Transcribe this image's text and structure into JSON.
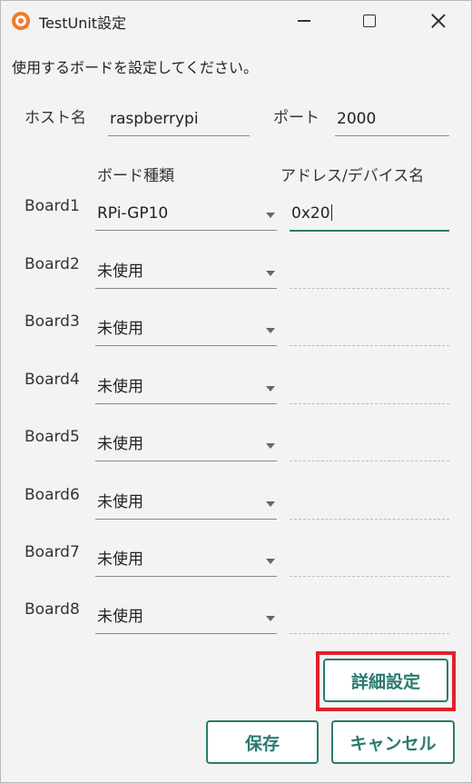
{
  "window": {
    "title": "TestUnit設定"
  },
  "instruction": "使用するボードを設定してください。",
  "host": {
    "label": "ホスト名",
    "value": "raspberrypi"
  },
  "port": {
    "label": "ポート",
    "value": "2000"
  },
  "columns": {
    "board_type": "ボード種類",
    "address": "アドレス/デバイス名"
  },
  "boards": [
    {
      "label": "Board1",
      "type": "RPi-GP10",
      "address": "0x20"
    },
    {
      "label": "Board2",
      "type": "未使用",
      "address": ""
    },
    {
      "label": "Board3",
      "type": "未使用",
      "address": ""
    },
    {
      "label": "Board4",
      "type": "未使用",
      "address": ""
    },
    {
      "label": "Board5",
      "type": "未使用",
      "address": ""
    },
    {
      "label": "Board6",
      "type": "未使用",
      "address": ""
    },
    {
      "label": "Board7",
      "type": "未使用",
      "address": ""
    },
    {
      "label": "Board8",
      "type": "未使用",
      "address": ""
    }
  ],
  "buttons": {
    "advanced": "詳細設定",
    "save": "保存",
    "cancel": "キャンセル"
  },
  "colors": {
    "accent": "#2a7a6e",
    "highlight": "#e0202a",
    "app_icon": "#f07a2a"
  }
}
